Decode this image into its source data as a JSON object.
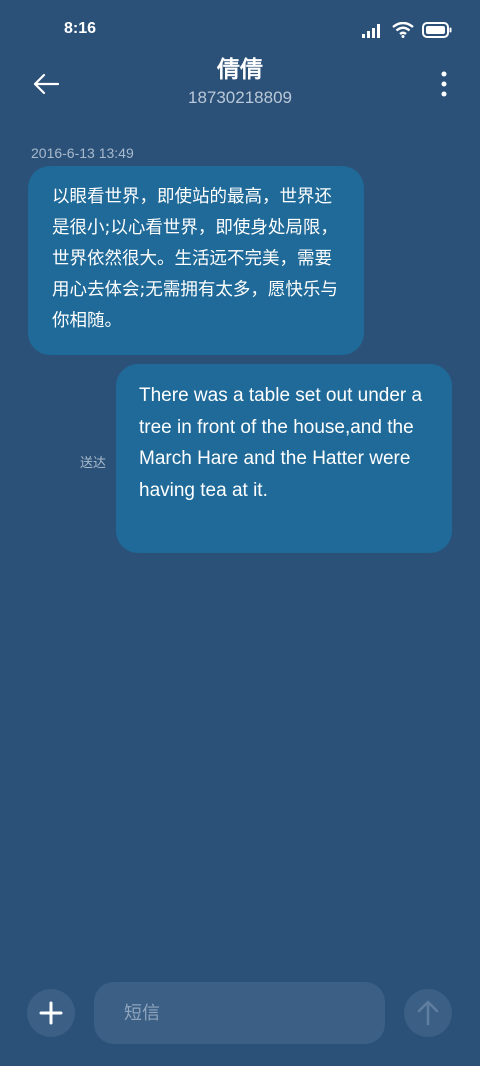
{
  "status_bar": {
    "time": "8:16",
    "icons": [
      "signal-icon",
      "wifi-icon",
      "battery-icon"
    ]
  },
  "header": {
    "contact_name": "倩倩",
    "contact_number": "18730218809",
    "icons": [
      "back-arrow-icon",
      "more-vert-icon"
    ]
  },
  "messages": [
    {
      "direction": "incoming",
      "timestamp": "2016-6-13 13:49",
      "text": "以眼看世界，即使站的最高，世界还是很小;以心看世界，即使身处局限，世界依然很大。生活远不完美，需要用心去体会;无需拥有太多，愿快乐与你相随。"
    },
    {
      "direction": "outgoing",
      "status": "送达",
      "text": "There was a table set out under a tree in front of the house,and the March Hare and the Hatter were having tea at it."
    }
  ],
  "composer": {
    "placeholder": "短信",
    "value": "",
    "icons": [
      "plus-icon",
      "send-arrow-up-icon"
    ]
  },
  "colors": {
    "background": "#2c5178",
    "bubble": "#1f6a98",
    "control": "#3b5f85",
    "muted_text": "#a8bacd"
  }
}
